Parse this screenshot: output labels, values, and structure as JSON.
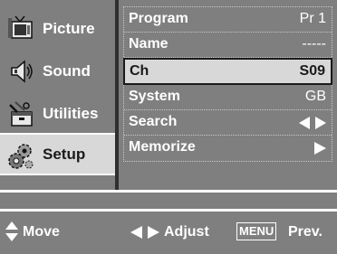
{
  "sidebar": {
    "items": [
      {
        "label": "Picture",
        "icon": "picture-icon"
      },
      {
        "label": "Sound",
        "icon": "speaker-icon"
      },
      {
        "label": "Utilities",
        "icon": "toolbox-icon"
      },
      {
        "label": "Setup",
        "icon": "gears-icon",
        "active": true
      }
    ]
  },
  "menu": {
    "rows": [
      {
        "key": "Program",
        "value": "Pr 1"
      },
      {
        "key": "Name",
        "value": "-----"
      },
      {
        "key": "Ch",
        "value": "S09",
        "selected": true
      },
      {
        "key": "System",
        "value": "GB"
      },
      {
        "key": "Search",
        "value_icon": "left-right-arrows-icon"
      },
      {
        "key": "Memorize",
        "value_icon": "right-arrow-icon"
      }
    ]
  },
  "footer": {
    "move_label": "Move",
    "adjust_label": "Adjust",
    "menu_key": "MENU",
    "prev_label": "Prev."
  },
  "colors": {
    "panel": "#7f7f7f",
    "highlight": "#d8d8d8",
    "text_light": "#ffffff",
    "text_dark": "#1a1a1a"
  }
}
